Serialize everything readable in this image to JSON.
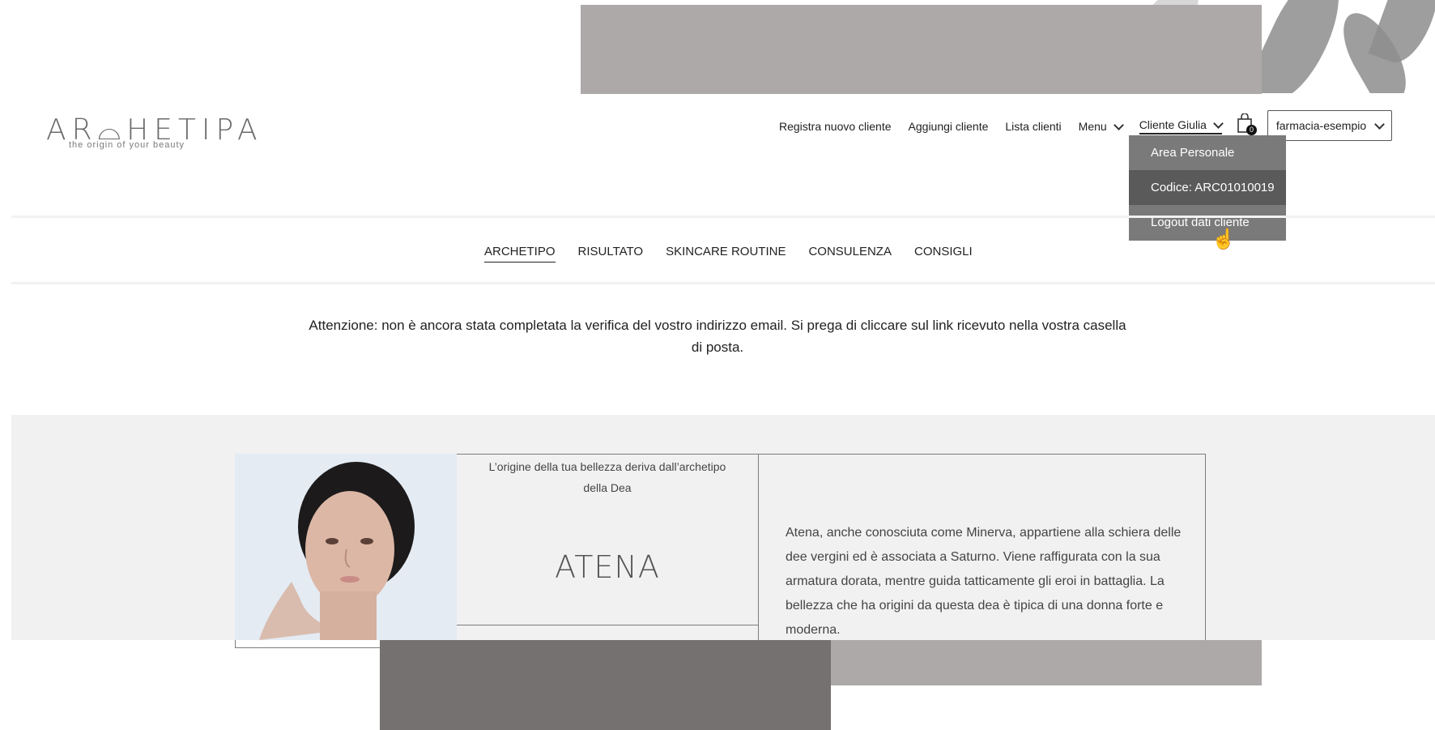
{
  "brand": {
    "logo_text": "AR⌓HETIPA",
    "tagline": "the origin of your beauty"
  },
  "top_nav": {
    "register": "Registra nuovo cliente",
    "add_client": "Aggiungi cliente",
    "client_list": "Lista clienti",
    "menu": "Menu",
    "client": "Cliente Giulia",
    "cart_count": "0",
    "store": "farmacia-esempio"
  },
  "client_dropdown": {
    "items": [
      "Area Personale",
      "Codice: ARC01010019",
      "Logout dati cliente"
    ]
  },
  "section_nav": {
    "items": [
      "ARCHETIPO",
      "RISULTATO",
      "SKINCARE ROUTINE",
      "CONSULENZA",
      "CONSIGLI"
    ]
  },
  "notice": "Attenzione: non è ancora stata completata la verifica del vostro indirizzo email. Si prega di cliccare sul link ricevuto nella vostra casella di posta.",
  "archetype": {
    "origin_text": "L’origine della tua bellezza deriva dall’archetipo della Dea",
    "name": "ATENA",
    "description": "Atena, anche conosciuta come Minerva, appartiene alla schiera delle dee vergini ed è associata a Saturno. Viene raffigurata con la sua armatura dorata, mentre guida tatticamente gli eroi in battaglia. La bellezza che ha origini da questa dea è tipica di una donna forte e moderna."
  }
}
